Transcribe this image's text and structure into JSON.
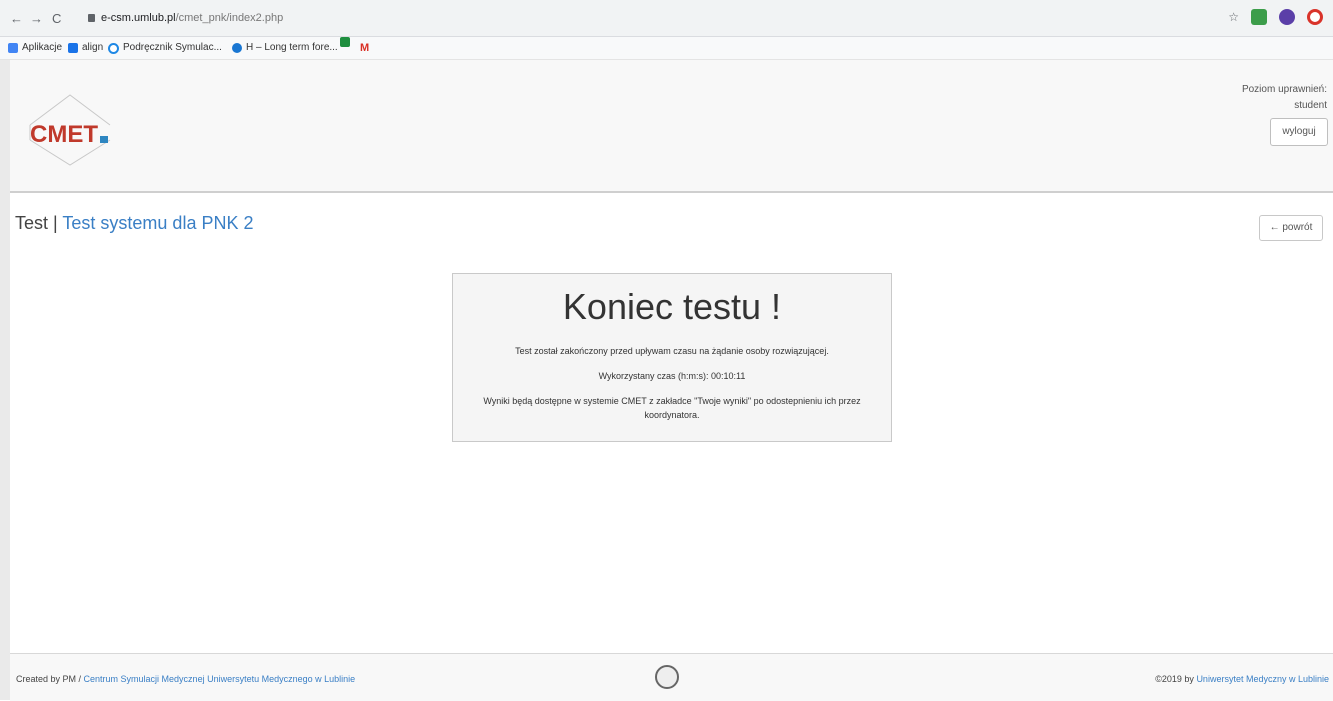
{
  "browser": {
    "url_host": "e-csm.umlub.pl",
    "url_path": "/cmet_pnk/index2.php",
    "bookmarks": [
      {
        "label": "Aplikacje",
        "color": "#4285f4"
      },
      {
        "label": "align",
        "color": "#1a73e8"
      },
      {
        "label": "Podręcznik Symulac...",
        "color": "#1e88e5"
      },
      {
        "label": "H – Long term fore...",
        "color": "#1976d2"
      },
      {
        "label": "",
        "color": "#1e8e3e"
      },
      {
        "label": "",
        "color": "#d93025"
      }
    ],
    "gmail_label": "M"
  },
  "header": {
    "logo_text": "CMET",
    "permission_label": "Poziom uprawnień:",
    "permission_value": "student",
    "logout_label": "wyloguj"
  },
  "title": {
    "prefix": "Test",
    "separator": "|",
    "name": "Test systemu dla PNK 2"
  },
  "back_button": {
    "label": "← powrót"
  },
  "result": {
    "heading": "Koniec testu !",
    "message": "Test został zakończony przed upływam czasu na żądanie osoby rozwiązującej.",
    "time_used": "Wykorzystany czas (h:m:s): 00:10:11",
    "results_info": "Wyniki będą dostępne w systemie CMET z zakładce \"Twoje wyniki\" po odostepnieniu ich przez koordynatora."
  },
  "footer": {
    "created_by": "Created by PM / ",
    "center_link": "Centrum Symulacji Medycznej Uniwersytetu Medycznego w Lublinie",
    "copyright": "©2019 by ",
    "university_link": "Uniwersytet Medyczny w Lublinie"
  }
}
